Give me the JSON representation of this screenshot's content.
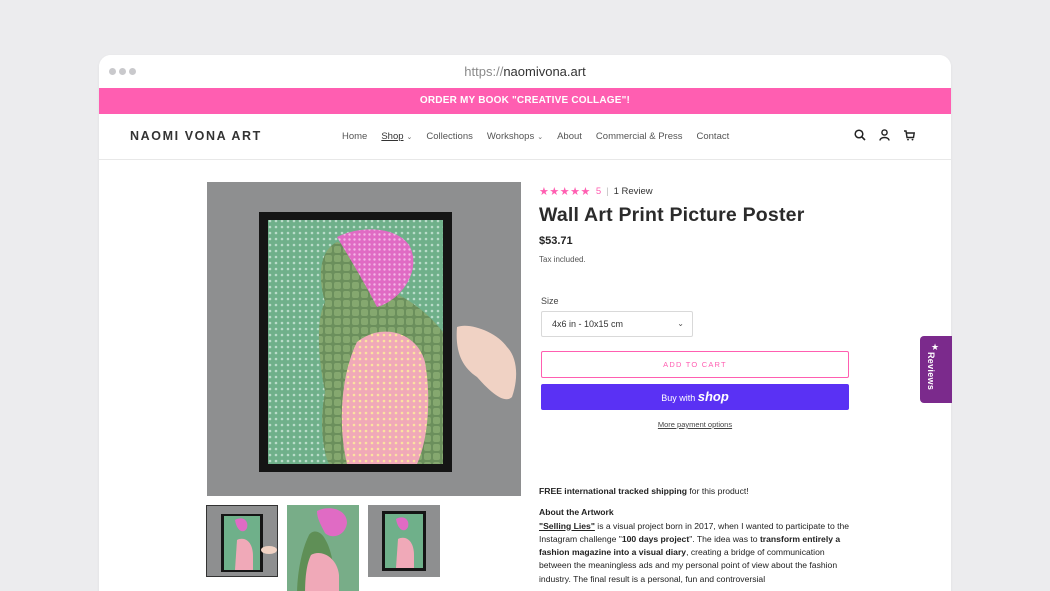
{
  "browser": {
    "url_protocol": "https://",
    "url_host": "naomivona.art"
  },
  "announcement": "ORDER MY BOOK \"CREATIVE COLLAGE\"!",
  "header": {
    "logo": "NAOMI VONA ART",
    "nav": [
      {
        "label": "Home",
        "dropdown": false,
        "active": false
      },
      {
        "label": "Shop",
        "dropdown": true,
        "active": true
      },
      {
        "label": "Collections",
        "dropdown": false,
        "active": false
      },
      {
        "label": "Workshops",
        "dropdown": true,
        "active": false
      },
      {
        "label": "About",
        "dropdown": false,
        "active": false
      },
      {
        "label": "Commercial & Press",
        "dropdown": false,
        "active": false
      },
      {
        "label": "Contact",
        "dropdown": false,
        "active": false
      }
    ],
    "icons": [
      "search-icon",
      "account-icon",
      "cart-icon"
    ]
  },
  "product": {
    "rating_stars": "★★★★★",
    "rating_value": "5",
    "review_count": "1 Review",
    "title": "Wall Art Print Picture Poster",
    "price": "$53.71",
    "tax_note": "Tax included.",
    "size_label": "Size",
    "size_selected": "4x6 in - 10x15 cm",
    "add_to_cart": "ADD TO CART",
    "buy_with": "Buy with",
    "shop_brand": "shop",
    "more_payment": "More payment options"
  },
  "description": {
    "shipping_bold": "FREE international tracked shipping",
    "shipping_rest": " for this product!",
    "about_heading": "About the Artwork",
    "line1_link": "\"Selling Lies\"",
    "line1_rest": " is a visual project born in 2017, when I wanted to participate to the Instagram challenge \"",
    "line1_bold": "100 days project",
    "line1_rest2": "\". The idea was to ",
    "line1_bold2": "transform entirely a fashion magazine into a visual diary",
    "line1_rest3": ", creating a bridge of communication between the meaningless ads and my personal point of view about the fashion industry. The final result is a personal, fun and controversial"
  },
  "reviews_tab": "Reviews",
  "colors": {
    "accent_pink": "#ff5eb1",
    "shop_purple": "#5a31f4",
    "reviews_purple": "#7b2a8c"
  }
}
